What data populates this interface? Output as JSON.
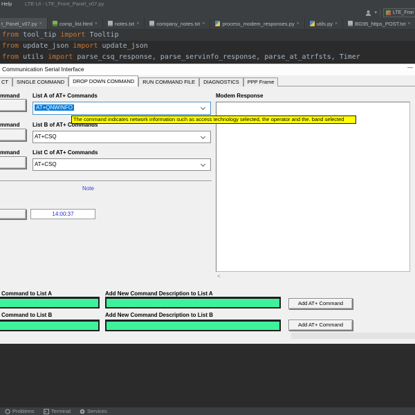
{
  "colors": {
    "selection_blue": "#0078d7",
    "tooltip_yellow": "#ffff00",
    "entry_green": "#3df29b",
    "keyword_orange": "#cc7832"
  },
  "ide": {
    "help_menu": "Help",
    "window_title": "LTE-UI - LTE_Front_Panel_v07.py",
    "run_config_label": "LTE_Fron",
    "close_glyph": "×",
    "tabs": [
      {
        "label": "t_Panel_v07.py"
      },
      {
        "label": "comp_list.html"
      },
      {
        "label": "notes.txt"
      },
      {
        "label": "company_notes.txt"
      },
      {
        "label": "process_modem_responses.py"
      },
      {
        "label": "utils.py"
      },
      {
        "label": "BG95_https_POST.txt"
      }
    ],
    "code_lines": [
      {
        "t0": "from",
        "t1": " tool_tip ",
        "t2": "import",
        "t3": " Tooltip"
      },
      {
        "t0": "from",
        "t1": " update_json ",
        "t2": "import",
        "t3": " update_json"
      },
      {
        "t0": "from",
        "t1": " utils ",
        "t2": "import",
        "t3": " parse_csq_response, parse_servinfo_response, parse_at_atrfsts, Timer"
      }
    ],
    "statusbar": {
      "problems": "Problems",
      "terminal": "Terminal",
      "services": "Services"
    }
  },
  "app": {
    "title": "Communication Serial Interface",
    "minimize_glyph": "—",
    "tabs": [
      {
        "label": "CT"
      },
      {
        "label": "SINGLE COMMAND"
      },
      {
        "label": "DROP DOWN COMMAND"
      },
      {
        "label": "RUN COMMAND FILE"
      },
      {
        "label": "DIAGNOSTICS"
      },
      {
        "label": "PPP Frame"
      }
    ],
    "active_tab": "DROP DOWN COMMAND",
    "partial_send_label": "mmand",
    "lists": [
      {
        "label": "List A of AT+ Commands",
        "value": "AT+QNWINFO"
      },
      {
        "label": "List B of AT+ Commands",
        "value": "AT+CSQ"
      },
      {
        "label": "List C of AT+ Commands",
        "value": "AT+CSQ"
      }
    ],
    "tooltip_text": "The command indicates network information such as access technology selected, the operator and the. band selected",
    "note_label": "Note",
    "timer_value": "14:00:37",
    "modem_response_label": "Modem Response",
    "scrollbar_arrow": "<",
    "add_rows": [
      {
        "cmd_label": "Command to List A",
        "desc_label": "Add New Command Description to List A",
        "button_label": "Add AT+ Command"
      },
      {
        "cmd_label": "Command to List B",
        "desc_label": "Add New Command Description to List B",
        "button_label": "Add AT+ Command"
      }
    ]
  }
}
